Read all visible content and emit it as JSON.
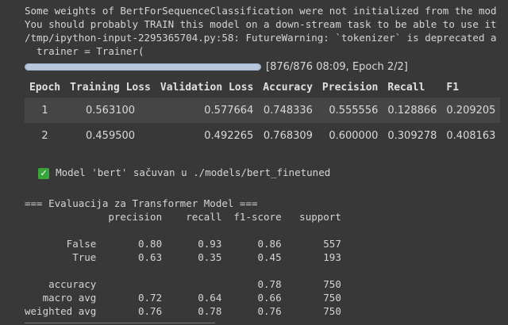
{
  "output_lines": [
    "Some weights of BertForSequenceClassification were not initialized from the mod",
    "You should probably TRAIN this model on a down-stream task to be able to use it",
    "/tmp/ipython-input-2295365704.py:58: FutureWarning: `tokenizer` is deprecated a",
    "  trainer = Trainer("
  ],
  "progress": {
    "fraction": 1.0,
    "text": "[876/876 08:09, Epoch 2/2]"
  },
  "train_table": {
    "headers": [
      "Epoch",
      "Training Loss",
      "Validation Loss",
      "Accuracy",
      "Precision",
      "Recall",
      "F1"
    ],
    "rows": [
      [
        "1",
        "0.563100",
        "0.577664",
        "0.748336",
        "0.555556",
        "0.128866",
        "0.209205"
      ],
      [
        "2",
        "0.459500",
        "0.492265",
        "0.768309",
        "0.600000",
        "0.309278",
        "0.408163"
      ]
    ]
  },
  "saved_message": {
    "icon": "check-icon",
    "glyph": "✓",
    "text": "Model 'bert' sačuvan u ./models/bert_finetuned"
  },
  "report": {
    "title": "=== Evaluacija za Transformer Model ===",
    "lines": [
      "              precision    recall  f1-score   support",
      "",
      "       False       0.80      0.93      0.86       557",
      "        True       0.63      0.35      0.45       193",
      "",
      "    accuracy                           0.78       750",
      "   macro avg       0.72      0.64      0.66       750",
      "weighted avg       0.76      0.78      0.76       750"
    ]
  }
}
